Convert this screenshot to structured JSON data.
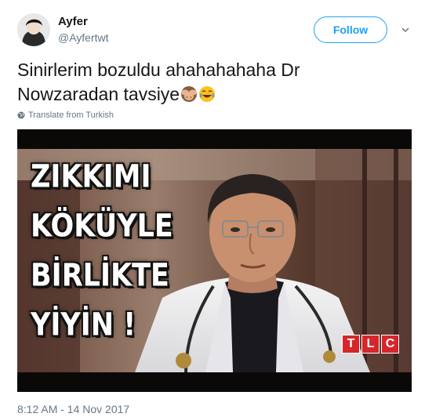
{
  "user": {
    "display_name": "Ayfer",
    "handle": "@Ayfertwt"
  },
  "actions": {
    "follow_label": "Follow"
  },
  "tweet": {
    "text_line1": "Sinirlerim bozuldu ahahahahaha Dr",
    "text_line2": "Nowzaradan tavsiye",
    "emojis": [
      "see-no-evil-monkey",
      "face-with-tears-of-joy"
    ],
    "translate_label": "Translate from Turkish",
    "timestamp": "8:12 AM - 14 Nov 2017"
  },
  "media": {
    "caption_lines": [
      "ZIKKIMI",
      "KÖKÜYLE",
      "BİRLİKTE",
      "YİYİN !"
    ],
    "watermark_letters": [
      "T",
      "L",
      "C"
    ]
  },
  "colors": {
    "accent": "#1da1f2",
    "muted": "#657786",
    "text": "#14171a",
    "watermark": "#d6262b"
  }
}
